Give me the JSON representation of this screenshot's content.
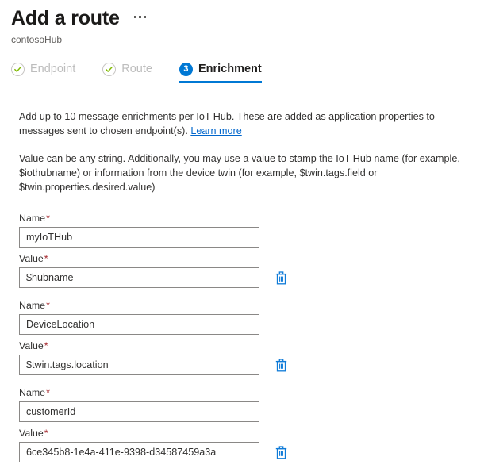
{
  "header": {
    "title": "Add a route",
    "subtitle": "contosoHub",
    "menu_label": "More options"
  },
  "tabs": [
    {
      "label": "Endpoint",
      "state": "done",
      "icon": "check-circle-icon"
    },
    {
      "label": "Route",
      "state": "done",
      "icon": "check-circle-icon"
    },
    {
      "label": "Enrichment",
      "state": "active",
      "badge": "3"
    }
  ],
  "description": {
    "line1_a": "Add up to 10 message enrichments per IoT Hub. These are added as application properties to messages sent to chosen endpoint(s). ",
    "link": "Learn more",
    "line2": "Value can be any string. Additionally, you may use a value to stamp the IoT Hub name (for example, $iothubname) or information from the device twin (for example, $twin.tags.field or $twin.properties.desired.value)"
  },
  "labels": {
    "name": "Name",
    "value": "Value",
    "required_mark": "*",
    "delete_icon": "trash-icon"
  },
  "enrichments": [
    {
      "name_value": "myIoTHub",
      "name_placeholder": "",
      "value_value": "$hubname",
      "value_placeholder": ""
    },
    {
      "name_value": "DeviceLocation",
      "name_placeholder": "",
      "value_value": "$twin.tags.location",
      "value_placeholder": ""
    },
    {
      "name_value": "customerId",
      "name_placeholder": "",
      "value_value": "6ce345b8-1e4a-411e-9398-d34587459a3a",
      "value_placeholder": ""
    }
  ],
  "colors": {
    "accent": "#0078d4",
    "link": "#0066cc",
    "required": "#a4262c",
    "check": "#7fba00",
    "border": "#8a8886",
    "disabled_text": "#bdbdbd"
  }
}
